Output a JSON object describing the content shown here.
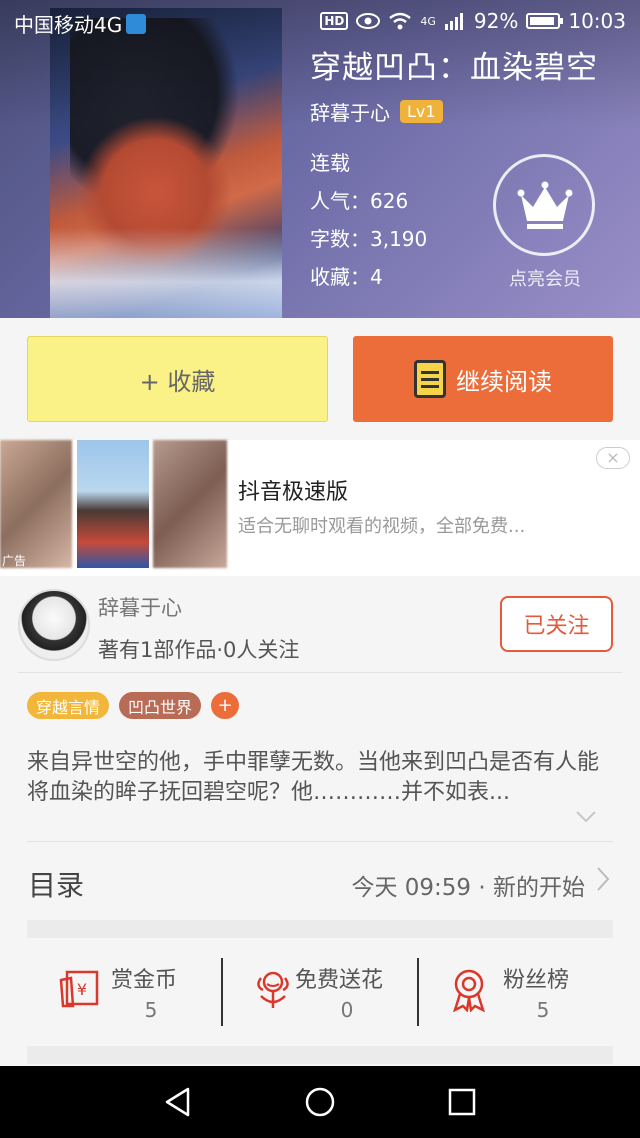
{
  "status_bar": {
    "carrier": "中国移动4G",
    "hd": "HD",
    "network": "4G",
    "battery_percent": "92%",
    "battery_level": 0.92,
    "time": "10:03"
  },
  "book": {
    "title": "穿越凹凸：血染碧空",
    "author": "辞暮于心",
    "level": "Lv1",
    "status": "连载",
    "popularity": "人气：626",
    "word_count": "字数：3,190",
    "favorites": "收藏：4"
  },
  "vip": {
    "label": "点亮会员"
  },
  "actions": {
    "favorite": "+ 收藏",
    "continue_reading": "继续阅读"
  },
  "ad": {
    "tag": "广告",
    "title": "抖音极速版",
    "description": "适合无聊时观看的视频，全部免费...",
    "close": "×"
  },
  "author_card": {
    "name": "辞暮于心",
    "stats": "著有1部作品·0人关注",
    "follow_button": "已关注"
  },
  "tags": [
    "穿越言情",
    "凹凸世界"
  ],
  "tag_add": "+",
  "description": "来自异世空的他，手中罪孽无数。当他来到凹凸是否有人能将血染的眸子抚回碧空呢？他…………并不如表...",
  "catalog": {
    "title": "目录",
    "latest": "今天 09:59 · 新的开始"
  },
  "stats": [
    {
      "label": "赏金币",
      "value": "5"
    },
    {
      "label": "免费送花",
      "value": "0"
    },
    {
      "label": "粉丝榜",
      "value": "5"
    }
  ],
  "colors": {
    "accent": "#ec6d39",
    "favorite_button": "#faf286",
    "follow": "#e45a3c",
    "tag_yellow": "#f2b73a",
    "tag_brown": "#b86b55"
  }
}
